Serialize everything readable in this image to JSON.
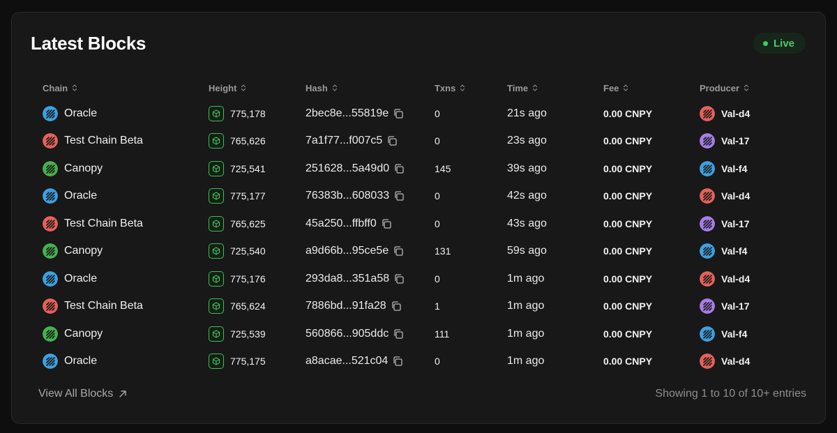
{
  "title": "Latest Blocks",
  "status": {
    "label": "Live",
    "color": "#3fcf5f"
  },
  "columns": [
    "Chain",
    "Height",
    "Hash",
    "Txns",
    "Time",
    "Fee",
    "Producer"
  ],
  "chain_colors": {
    "Oracle": "#3ea0e0",
    "Test Chain Beta": "#e4625a",
    "Canopy": "#46b24e"
  },
  "producer_colors": {
    "Val-d4": "#e4625a",
    "Val-17": "#a77ee8",
    "Val-f4": "#3ea0e0"
  },
  "rows": [
    {
      "chain": "Oracle",
      "height": "775,178",
      "hash": "2bec8e...55819e",
      "txns": "0",
      "time": "21s ago",
      "fee": "0.00 CNPY",
      "producer": "Val-d4"
    },
    {
      "chain": "Test Chain Beta",
      "height": "765,626",
      "hash": "7a1f77...f007c5",
      "txns": "0",
      "time": "23s ago",
      "fee": "0.00 CNPY",
      "producer": "Val-17"
    },
    {
      "chain": "Canopy",
      "height": "725,541",
      "hash": "251628...5a49d0",
      "txns": "145",
      "time": "39s ago",
      "fee": "0.00 CNPY",
      "producer": "Val-f4"
    },
    {
      "chain": "Oracle",
      "height": "775,177",
      "hash": "76383b...608033",
      "txns": "0",
      "time": "42s ago",
      "fee": "0.00 CNPY",
      "producer": "Val-d4"
    },
    {
      "chain": "Test Chain Beta",
      "height": "765,625",
      "hash": "45a250...ffbff0",
      "txns": "0",
      "time": "43s ago",
      "fee": "0.00 CNPY",
      "producer": "Val-17"
    },
    {
      "chain": "Canopy",
      "height": "725,540",
      "hash": "a9d66b...95ce5e",
      "txns": "131",
      "time": "59s ago",
      "fee": "0.00 CNPY",
      "producer": "Val-f4"
    },
    {
      "chain": "Oracle",
      "height": "775,176",
      "hash": "293da8...351a58",
      "txns": "0",
      "time": "1m ago",
      "fee": "0.00 CNPY",
      "producer": "Val-d4"
    },
    {
      "chain": "Test Chain Beta",
      "height": "765,624",
      "hash": "7886bd...91fa28",
      "txns": "1",
      "time": "1m ago",
      "fee": "0.00 CNPY",
      "producer": "Val-17"
    },
    {
      "chain": "Canopy",
      "height": "725,539",
      "hash": "560866...905ddc",
      "txns": "111",
      "time": "1m ago",
      "fee": "0.00 CNPY",
      "producer": "Val-f4"
    },
    {
      "chain": "Oracle",
      "height": "775,175",
      "hash": "a8acae...521c04",
      "txns": "0",
      "time": "1m ago",
      "fee": "0.00 CNPY",
      "producer": "Val-d4"
    }
  ],
  "footer": {
    "view_all": "View All Blocks",
    "showing": "Showing 1 to 10 of 10+ entries"
  }
}
